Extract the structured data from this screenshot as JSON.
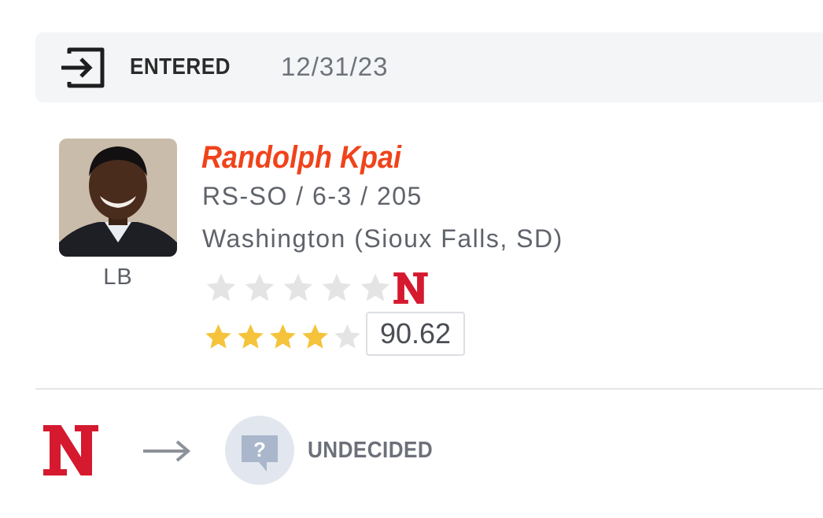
{
  "status": {
    "icon": "enter-icon",
    "label": "ENTERED",
    "date": "12/31/23"
  },
  "player": {
    "name": "Randolph Kpai",
    "meta": "RS-SO / 6-3 / 205",
    "hometown": "Washington (Sioux Falls, SD)",
    "position": "LB",
    "team_rating_stars": 0,
    "team_rating_max_stars": 5,
    "composite_stars": 4,
    "composite_max_stars": 5,
    "composite_rating": "90.62"
  },
  "transfer": {
    "from_team_logo": "nebraska-logo",
    "arrow": "arrow-right-icon",
    "to_icon": "question-bubble-icon",
    "destination": "UNDECIDED"
  },
  "colors": {
    "name_accent": "#f0431b",
    "star_gold": "#f5c33b",
    "star_empty": "#e4e4e4",
    "nebraska_red": "#d5192f",
    "status_bg": "#f4f5f7"
  }
}
